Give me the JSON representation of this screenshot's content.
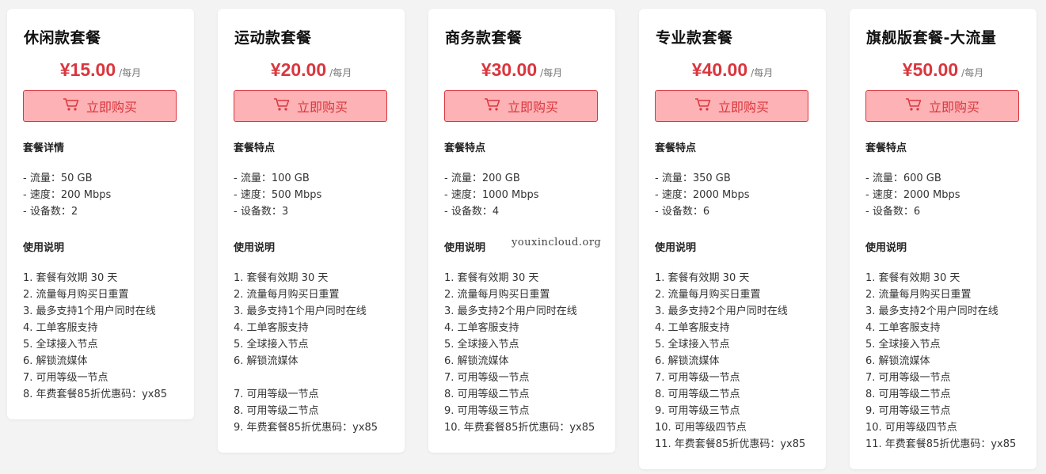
{
  "watermark": "youxincloud.org",
  "cards": [
    {
      "title": "休闲款套餐",
      "price": "¥15.00",
      "period": "/每月",
      "buy_label": "立即购买",
      "feature_head": "套餐详情",
      "features": [
        "- 流量：50 GB",
        "- 速度：200 Mbps",
        "- 设备数：2"
      ],
      "usage_head": "使用说明",
      "usage": [
        "1. 套餐有效期 30 天",
        "2. 流量每月购买日重置",
        "3. 最多支持1个用户同时在线",
        "4. 工单客服支持",
        "5. 全球接入节点",
        "6. 解锁流媒体",
        "7. 可用等级一节点",
        "8. 年费套餐85折优惠码：yx85"
      ]
    },
    {
      "title": "运动款套餐",
      "price": "¥20.00",
      "period": "/每月",
      "buy_label": "立即购买",
      "feature_head": "套餐特点",
      "features": [
        "- 流量：100 GB",
        "- 速度：500 Mbps",
        "- 设备数：3"
      ],
      "usage_head": "使用说明",
      "usage": [
        "1. 套餐有效期 30 天",
        "2. 流量每月购买日重置",
        "3. 最多支持1个用户同时在线",
        "4. 工单客服支持",
        "5. 全球接入节点",
        "6. 解锁流媒体",
        "",
        "7. 可用等级一节点",
        "8. 可用等级二节点",
        "9. 年费套餐85折优惠码：yx85"
      ]
    },
    {
      "title": "商务款套餐",
      "price": "¥30.00",
      "period": "/每月",
      "buy_label": "立即购买",
      "feature_head": "套餐特点",
      "features": [
        "- 流量：200 GB",
        "- 速度：1000 Mbps",
        "- 设备数：4"
      ],
      "usage_head": "使用说明",
      "usage": [
        "1. 套餐有效期 30 天",
        "2. 流量每月购买日重置",
        "3. 最多支持2个用户同时在线",
        "4. 工单客服支持",
        "5. 全球接入节点",
        "6. 解锁流媒体",
        "7. 可用等级一节点",
        "8. 可用等级二节点",
        "9. 可用等级三节点",
        "10. 年费套餐85折优惠码：yx85"
      ]
    },
    {
      "title": "专业款套餐",
      "price": "¥40.00",
      "period": "/每月",
      "buy_label": "立即购买",
      "feature_head": "套餐特点",
      "features": [
        "- 流量：350 GB",
        "- 速度：2000 Mbps",
        "- 设备数：6"
      ],
      "usage_head": "使用说明",
      "usage": [
        "1. 套餐有效期 30 天",
        "2. 流量每月购买日重置",
        "3. 最多支持2个用户同时在线",
        "4. 工单客服支持",
        "5. 全球接入节点",
        "6. 解锁流媒体",
        "7. 可用等级一节点",
        "8. 可用等级二节点",
        "9. 可用等级三节点",
        "10. 可用等级四节点",
        "11. 年费套餐85折优惠码：yx85"
      ]
    },
    {
      "title": "旗舰版套餐-大流量",
      "price": "¥50.00",
      "period": "/每月",
      "buy_label": "立即购买",
      "feature_head": "套餐特点",
      "features": [
        "- 流量：600 GB",
        "- 速度：2000 Mbps",
        "- 设备数：6"
      ],
      "usage_head": "使用说明",
      "usage": [
        "1. 套餐有效期 30 天",
        "2. 流量每月购买日重置",
        "3. 最多支持2个用户同时在线",
        "4. 工单客服支持",
        "5. 全球接入节点",
        "6. 解锁流媒体",
        "7. 可用等级一节点",
        "8. 可用等级二节点",
        "9. 可用等级三节点",
        "10. 可用等级四节点",
        "11. 年费套餐85折优惠码：yx85"
      ]
    }
  ]
}
